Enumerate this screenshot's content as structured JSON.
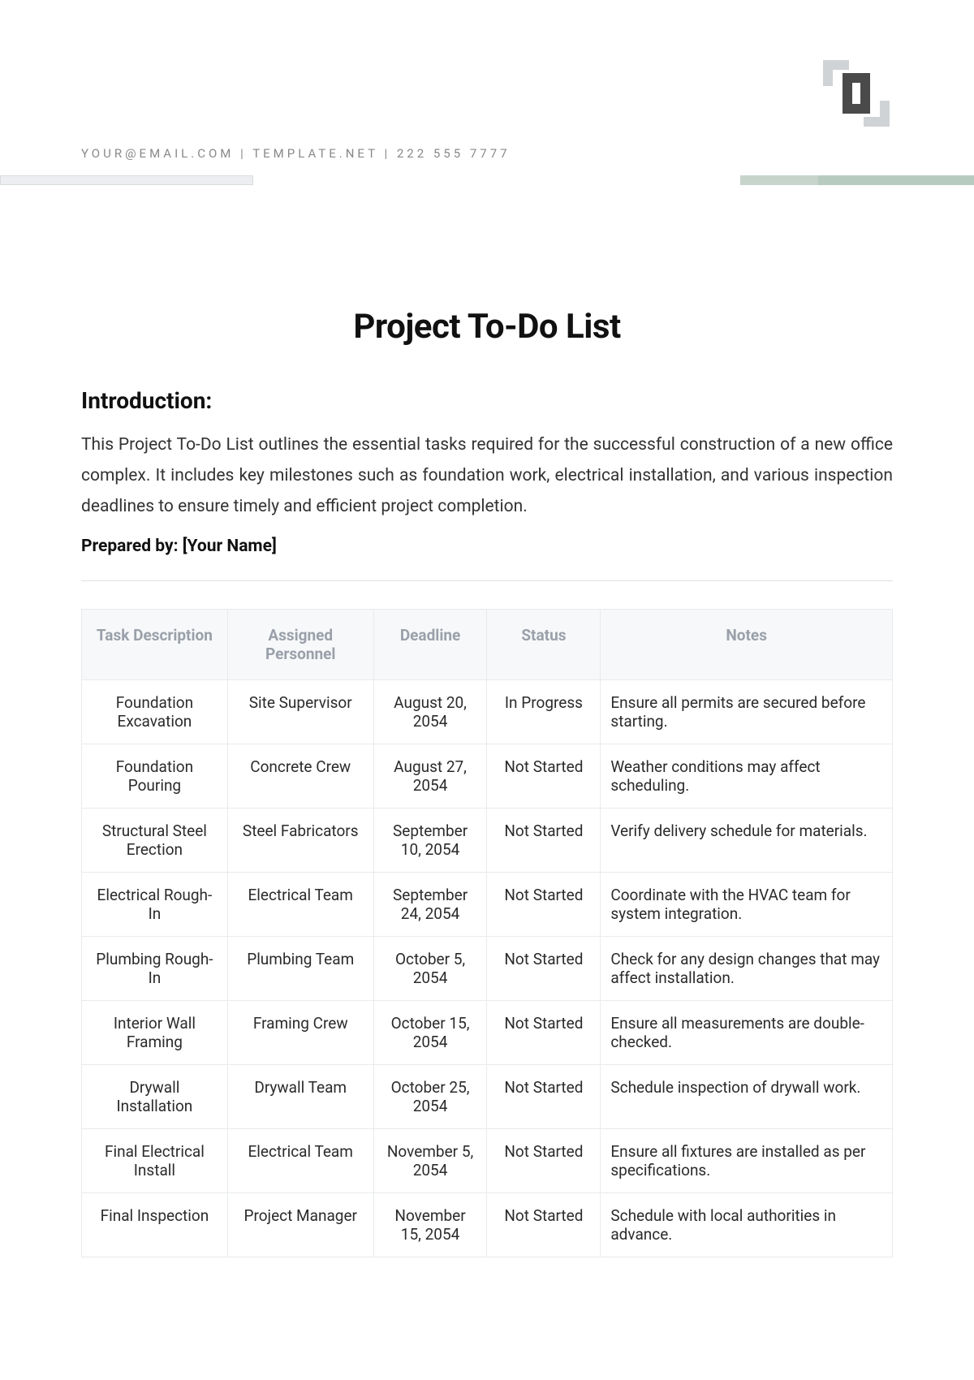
{
  "header": {
    "contact_line": "YOUR@EMAIL.COM | TEMPLATE.NET | 222 555 7777"
  },
  "title": "Project To-Do List",
  "intro": {
    "heading": "Introduction:",
    "text": "This Project To-Do List outlines the essential tasks required for the successful construction of a new office complex. It includes key milestones such as foundation work, electrical installation, and various inspection deadlines to ensure timely and efficient project completion.",
    "prepared_by": "Prepared by: [Your Name]"
  },
  "table": {
    "columns": [
      "Task Description",
      "Assigned Personnel",
      "Deadline",
      "Status",
      "Notes"
    ],
    "rows": [
      {
        "task": "Foundation Excavation",
        "person": "Site Supervisor",
        "deadline": "August 20, 2054",
        "status": "In Progress",
        "notes": "Ensure all permits are secured before starting."
      },
      {
        "task": "Foundation Pouring",
        "person": "Concrete Crew",
        "deadline": "August 27, 2054",
        "status": "Not Started",
        "notes": "Weather conditions may affect scheduling."
      },
      {
        "task": "Structural Steel Erection",
        "person": "Steel Fabricators",
        "deadline": "September 10, 2054",
        "status": "Not Started",
        "notes": "Verify delivery schedule for materials."
      },
      {
        "task": "Electrical Rough-In",
        "person": "Electrical Team",
        "deadline": "September 24, 2054",
        "status": "Not Started",
        "notes": "Coordinate with the HVAC team for system integration."
      },
      {
        "task": "Plumbing Rough-In",
        "person": "Plumbing Team",
        "deadline": "October 5, 2054",
        "status": "Not Started",
        "notes": "Check for any design changes that may affect installation."
      },
      {
        "task": "Interior Wall Framing",
        "person": "Framing Crew",
        "deadline": "October 15, 2054",
        "status": "Not Started",
        "notes": "Ensure all measurements are double-checked."
      },
      {
        "task": "Drywall Installation",
        "person": "Drywall Team",
        "deadline": "October 25, 2054",
        "status": "Not Started",
        "notes": "Schedule inspection of drywall work."
      },
      {
        "task": "Final Electrical Install",
        "person": "Electrical Team",
        "deadline": "November 5, 2054",
        "status": "Not Started",
        "notes": "Ensure all fixtures are installed as per specifications."
      },
      {
        "task": "Final Inspection",
        "person": "Project Manager",
        "deadline": "November 15, 2054",
        "status": "Not Started",
        "notes": "Schedule with local authorities in advance."
      }
    ]
  }
}
